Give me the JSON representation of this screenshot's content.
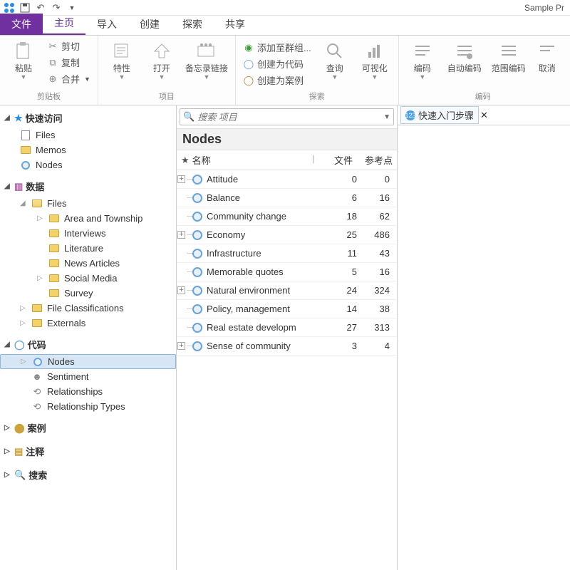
{
  "app": {
    "title": "Sample Pr"
  },
  "qat": {
    "items": [
      "app-icon",
      "save",
      "undo",
      "redo"
    ]
  },
  "ribbon_tabs": [
    {
      "id": "file",
      "label": "文件"
    },
    {
      "id": "home",
      "label": "主页",
      "active": true
    },
    {
      "id": "import",
      "label": "导入"
    },
    {
      "id": "create",
      "label": "创建"
    },
    {
      "id": "explore",
      "label": "探索"
    },
    {
      "id": "share",
      "label": "共享"
    }
  ],
  "ribbon": {
    "clipboard": {
      "label": "剪贴板",
      "paste": "粘贴",
      "cut": "剪切",
      "copy": "复制",
      "merge": "合并"
    },
    "item": {
      "label": "项目",
      "properties": "特性",
      "open": "打开",
      "memo_link": "备忘录链接"
    },
    "explore": {
      "label": "探索",
      "add_group": "添加至群组...",
      "create_code": "创建为代码",
      "create_case": "创建为案例",
      "query": "查询",
      "visualize": "可视化"
    },
    "coding": {
      "label": "编码",
      "code": "编码",
      "autocode": "自动编码",
      "range": "范围编码",
      "cancel": "取消"
    }
  },
  "nav": {
    "quick": {
      "label": "快速访问",
      "items": [
        {
          "id": "files",
          "label": "Files",
          "icon": "doc"
        },
        {
          "id": "memos",
          "label": "Memos",
          "icon": "folder"
        },
        {
          "id": "nodes",
          "label": "Nodes",
          "icon": "node"
        }
      ]
    },
    "data": {
      "label": "数据",
      "items": [
        {
          "id": "files",
          "label": "Files",
          "icon": "folder",
          "expanded": true,
          "children": [
            {
              "id": "area",
              "label": "Area and Township",
              "icon": "folder"
            },
            {
              "id": "interviews",
              "label": "Interviews",
              "icon": "folder"
            },
            {
              "id": "literature",
              "label": "Literature",
              "icon": "folder"
            },
            {
              "id": "news",
              "label": "News Articles",
              "icon": "folder"
            },
            {
              "id": "social",
              "label": "Social Media",
              "icon": "folder"
            },
            {
              "id": "survey",
              "label": "Survey",
              "icon": "folder"
            }
          ]
        },
        {
          "id": "fileclass",
          "label": "File Classifications",
          "icon": "folder"
        },
        {
          "id": "externals",
          "label": "Externals",
          "icon": "folder"
        }
      ]
    },
    "code": {
      "label": "代码",
      "items": [
        {
          "id": "nodes",
          "label": "Nodes",
          "icon": "node",
          "selected": true
        },
        {
          "id": "sentiment",
          "label": "Sentiment",
          "icon": "gear"
        },
        {
          "id": "relationships",
          "label": "Relationships",
          "icon": "gear"
        },
        {
          "id": "reltypes",
          "label": "Relationship Types",
          "icon": "gear"
        }
      ]
    },
    "cases": {
      "label": "案例"
    },
    "notes": {
      "label": "注释"
    },
    "search": {
      "label": "搜索"
    }
  },
  "center": {
    "search_placeholder": "搜索 项目",
    "title": "Nodes",
    "columns": {
      "name": "名称",
      "file": "文件",
      "ref": "参考点"
    },
    "rows": [
      {
        "name": "Attitude",
        "file": 0,
        "ref": 0,
        "expandable": true
      },
      {
        "name": "Balance",
        "file": 6,
        "ref": 16,
        "expandable": false
      },
      {
        "name": "Community change",
        "file": 18,
        "ref": 62,
        "expandable": false
      },
      {
        "name": "Economy",
        "file": 25,
        "ref": 486,
        "expandable": true
      },
      {
        "name": "Infrastructure",
        "file": 11,
        "ref": 43,
        "expandable": false
      },
      {
        "name": "Memorable quotes",
        "file": 5,
        "ref": 16,
        "expandable": false
      },
      {
        "name": "Natural environment",
        "file": 24,
        "ref": 324,
        "expandable": true
      },
      {
        "name": "Policy, management",
        "file": 14,
        "ref": 38,
        "expandable": false
      },
      {
        "name": "Real estate developm",
        "file": 27,
        "ref": 313,
        "expandable": false
      },
      {
        "name": "Sense of community",
        "file": 3,
        "ref": 4,
        "expandable": true
      }
    ]
  },
  "detail": {
    "tab_label": "快速入门步骤"
  }
}
